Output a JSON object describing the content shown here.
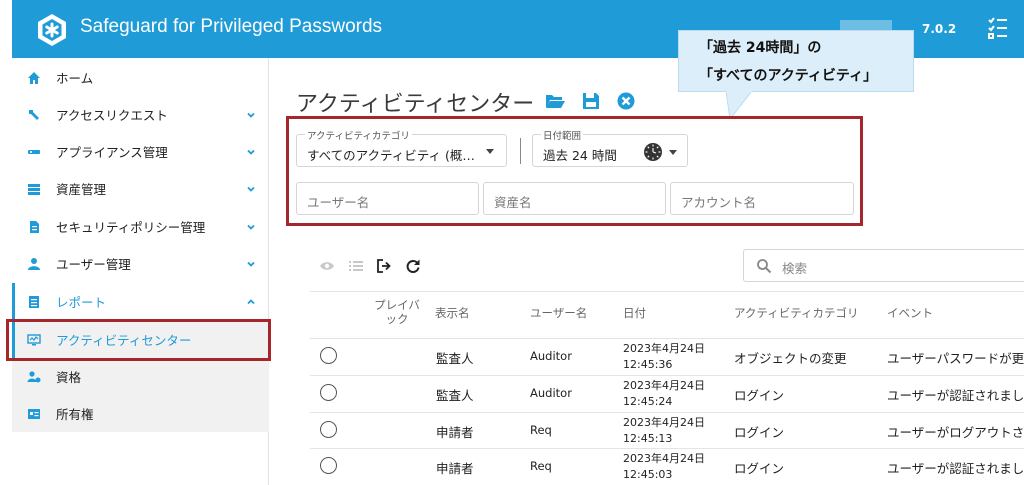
{
  "header": {
    "app_title": "Safeguard for Privileged Passwords",
    "version": "7.0.2",
    "accent": "#1f9bd7"
  },
  "sidebar": {
    "items": [
      {
        "label": "ホーム",
        "icon": "home-icon"
      },
      {
        "label": "アクセスリクエスト",
        "icon": "wrench-icon"
      },
      {
        "label": "アプライアンス管理",
        "icon": "appliance-icon"
      },
      {
        "label": "資産管理",
        "icon": "asset-list-icon"
      },
      {
        "label": "セキュリティポリシー管理",
        "icon": "policy-icon"
      },
      {
        "label": "ユーザー管理",
        "icon": "user-icon"
      },
      {
        "label": "レポート",
        "icon": "report-icon"
      },
      {
        "label": "アクティビティセンター",
        "icon": "activity-monitor-icon"
      },
      {
        "label": "資格",
        "icon": "entitlement-icon"
      },
      {
        "label": "所有権",
        "icon": "ownership-card-icon"
      }
    ]
  },
  "main": {
    "title": "アクティビティセンター",
    "filters": {
      "category_label": "アクティビティカテゴリ",
      "category_value": "すべてのアクティビティ (概…",
      "date_label": "日付範囲",
      "date_value": "過去 24 時間",
      "username_placeholder": "ユーザー名",
      "asset_placeholder": "資産名",
      "account_placeholder": "アカウント名"
    },
    "search_placeholder": "検索",
    "columns": {
      "playback": "プレイバック",
      "display_name": "表示名",
      "user_name": "ユーザー名",
      "date": "日付",
      "category": "アクティビティカテゴリ",
      "event": "イベント"
    },
    "rows": [
      {
        "display_name": "監査人",
        "user_name": "Auditor",
        "date": "2023年4月24日",
        "time": "12:45:36",
        "category": "オブジェクトの変更",
        "event": "ユーザーパスワードが更"
      },
      {
        "display_name": "監査人",
        "user_name": "Auditor",
        "date": "2023年4月24日",
        "time": "12:45:24",
        "category": "ログイン",
        "event": "ユーザーが認証されまし"
      },
      {
        "display_name": "申請者",
        "user_name": "Req",
        "date": "2023年4月24日",
        "time": "12:45:13",
        "category": "ログイン",
        "event": "ユーザーがログアウトさ"
      },
      {
        "display_name": "申請者",
        "user_name": "Req",
        "date": "2023年4月24日",
        "time": "12:45:03",
        "category": "ログイン",
        "event": "ユーザーが認証されまし"
      }
    ]
  },
  "callout": {
    "line1": "「過去 24時間」の",
    "line2": "「すべてのアクティビティ」"
  }
}
